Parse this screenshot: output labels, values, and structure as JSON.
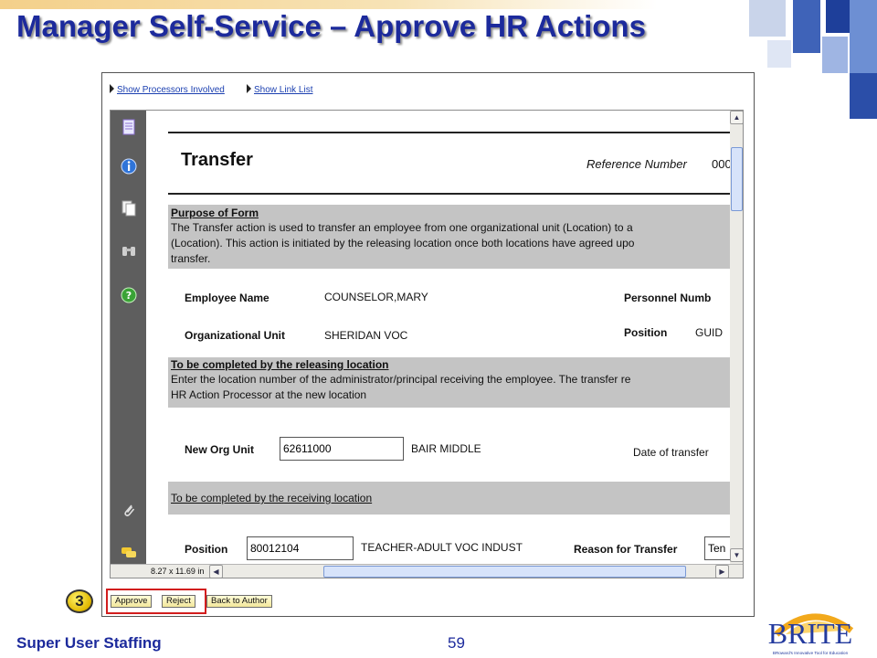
{
  "slide": {
    "title": "Manager Self-Service – Approve HR Actions",
    "footer_left": "Super User Staffing",
    "page_number": "59",
    "logo_text": "BRITE",
    "logo_tagline": "BRoward's Innovative Tool for Education"
  },
  "links": {
    "processors": "Show Processors Involved",
    "link_list": "Show Link List"
  },
  "viewer": {
    "page_size": "8.27 x 11.69 in"
  },
  "form": {
    "heading": "Transfer",
    "reference_label": "Reference Number",
    "reference_value": "000",
    "purpose_title": "Purpose of Form",
    "purpose_lines": [
      "The Transfer action is used to transfer an employee from one organizational unit (Location) to a",
      "(Location). This action is initiated by the releasing location once both locations have agreed upo",
      "transfer."
    ],
    "employee_name_label": "Employee Name",
    "employee_name_value": "COUNSELOR,MARY",
    "personnel_number_label": "Personnel Numb",
    "org_unit_label": "Organizational Unit",
    "org_unit_value": "SHERIDAN VOC",
    "position_label_top": "Position",
    "position_value_top": "GUID",
    "releasing_title": "To be completed by the releasing location",
    "releasing_lines": [
      "Enter the location number of the administrator/principal receiving the employee. The transfer re",
      "HR Action Processor at the new location"
    ],
    "new_org_label": "New Org Unit",
    "new_org_value": "62611000",
    "new_org_name": "BAIR MIDDLE",
    "date_of_transfer_label": "Date of transfer",
    "receiving_title": "To be completed by the receiving location",
    "position_label": "Position",
    "position_value": "80012104",
    "position_name": "TEACHER-ADULT VOC INDUST",
    "reason_label": "Reason for Transfer",
    "reason_value": "Ten"
  },
  "buttons": {
    "approve": "Approve",
    "reject": "Reject",
    "back_to_author": "Back to Author"
  },
  "step": {
    "number": "3"
  },
  "colors": {
    "title": "#1c2a9c",
    "highlight_border": "#d21e1e",
    "section_gray": "#c4c4c4",
    "sidebar": "#5e5e5e"
  }
}
